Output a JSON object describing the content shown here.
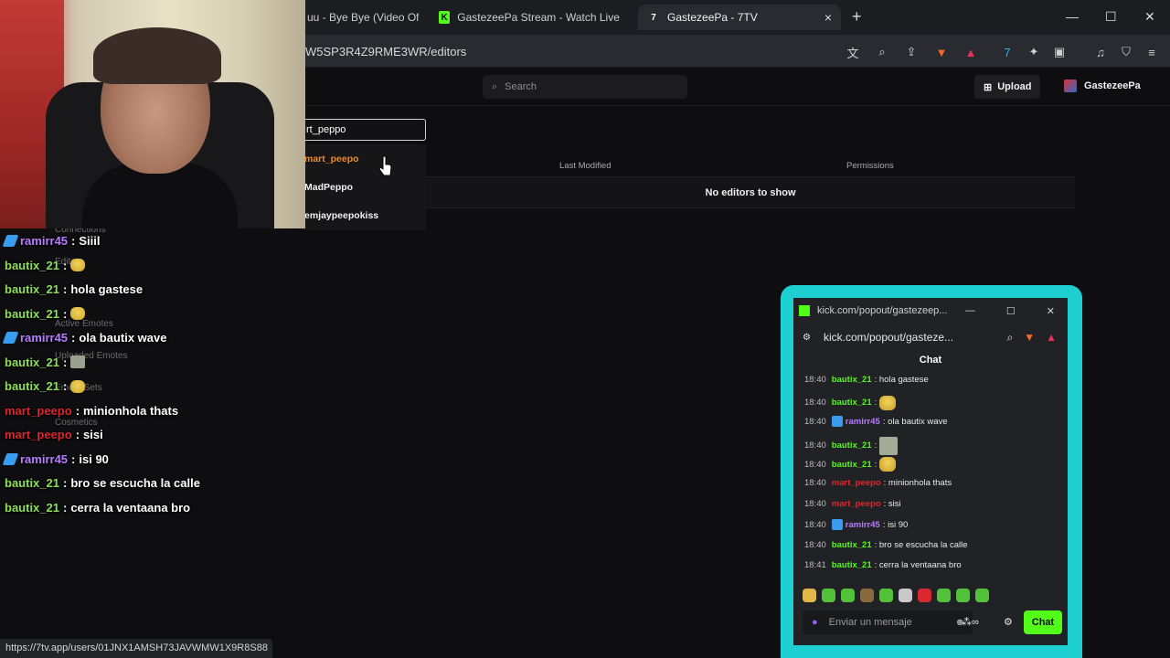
{
  "browser": {
    "tabs": [
      {
        "label": "uu - Bye Bye (Video Ofic",
        "icon": "youtube-icon"
      },
      {
        "label": "GastezeePa Stream - Watch Live on K",
        "icon": "kick-icon"
      },
      {
        "label": "GastezeePa - 7TV",
        "icon": "7tv-icon"
      }
    ],
    "close_tab": "×",
    "new_tab": "+",
    "url": "W5SP3R4Z9RME3WR/editors",
    "window_controls": {
      "minimize": "—",
      "maximize": "☐",
      "close": "✕"
    }
  },
  "seventv": {
    "search_placeholder": "Search",
    "upload_label": "Upload",
    "username": "GastezeePa",
    "editor_input_value": "rt_peppo",
    "dropdown": [
      "mart_peepo",
      "MadPeppo",
      "emjaypeepokiss"
    ],
    "table_headers": {
      "last_modified": "Last Modified",
      "permissions": "Permissions"
    },
    "empty_text": "No editors to show",
    "sidebar": [
      "Connections",
      "Editors",
      "Active Emotes",
      "Uploaded Emotes",
      "Emote Sets",
      "Cosmetics"
    ]
  },
  "overlay_chat": [
    {
      "user": "ramirr45",
      "user_color": "#b77cff",
      "badge": true,
      "text": "Siiil"
    },
    {
      "user": "bautix_21",
      "user_color": "#8ee05a",
      "emote": "minion"
    },
    {
      "user": "bautix_21",
      "user_color": "#8ee05a",
      "text": "hola gastese"
    },
    {
      "user": "bautix_21",
      "user_color": "#8ee05a",
      "emote": "minion"
    },
    {
      "user": "ramirr45",
      "user_color": "#b77cff",
      "badge": true,
      "text": "ola bautix wave"
    },
    {
      "user": "bautix_21",
      "user_color": "#8ee05a",
      "emote": "square"
    },
    {
      "user": "bautix_21",
      "user_color": "#8ee05a",
      "emote": "minion"
    },
    {
      "user": "mart_peepo",
      "user_color": "#d9282f",
      "text": "minionhola thats"
    },
    {
      "user": "mart_peepo",
      "user_color": "#d9282f",
      "text": "sisi"
    },
    {
      "user": "ramirr45",
      "user_color": "#b77cff",
      "badge": true,
      "text": "isi 90"
    },
    {
      "user": "bautix_21",
      "user_color": "#8ee05a",
      "text": "bro se escucha la calle"
    },
    {
      "user": "bautix_21",
      "user_color": "#8ee05a",
      "text": "cerra la ventaana bro"
    }
  ],
  "kick_popout": {
    "title": "kick.com/popout/gastezeep...",
    "address": "kick.com/popout/gasteze...",
    "chat_header": "Chat",
    "messages": [
      {
        "time": "18:40",
        "user": "bautix_21",
        "user_color": "#53fc18",
        "text": ": hola gastese"
      },
      {
        "time": "18:40",
        "user": "bautix_21",
        "user_color": "#53fc18",
        "text": ":",
        "emote": "minion"
      },
      {
        "time": "18:40",
        "user": "ramirr45",
        "user_color": "#b77cff",
        "badge": true,
        "text": ": ola bautix wave"
      },
      {
        "time": "18:40",
        "user": "bautix_21",
        "user_color": "#53fc18",
        "text": ":",
        "emote": "square"
      },
      {
        "time": "18:40",
        "user": "bautix_21",
        "user_color": "#53fc18",
        "text": ":",
        "emote": "minion"
      },
      {
        "time": "18:40",
        "user": "mart_peepo",
        "user_color": "#d9282f",
        "text": ": minionhola thats"
      },
      {
        "time": "18:40",
        "user": "mart_peepo",
        "user_color": "#d9282f",
        "text": ": sisi"
      },
      {
        "time": "18:40",
        "user": "ramirr45",
        "user_color": "#b77cff",
        "badge": true,
        "text": ": isi 90"
      },
      {
        "time": "18:40",
        "user": "bautix_21",
        "user_color": "#53fc18",
        "text": ": bro se escucha la calle"
      },
      {
        "time": "18:41",
        "user": "bautix_21",
        "user_color": "#53fc18",
        "text": ": cerra la ventaana bro"
      }
    ],
    "emote_colors": [
      "#e2b84a",
      "#53c23a",
      "#53c23a",
      "#8a6a3a",
      "#53c23a",
      "#c9c9c9",
      "#d9282f",
      "#53c23a",
      "#53c23a",
      "#53c23a"
    ],
    "input_placeholder": "Enviar un mensaje",
    "send_label": "Chat"
  },
  "status_url": "https://7tv.app/users/01JNX1AMSH73JAVWMW1X9R8S88"
}
